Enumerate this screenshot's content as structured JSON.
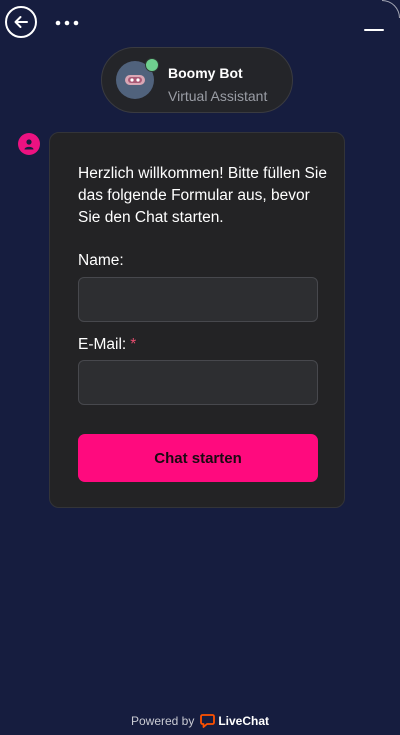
{
  "header": {
    "back_icon": "arrow-left-icon",
    "more_icon": "more-horizontal-icon",
    "minimize_icon": "minimize-icon"
  },
  "agent": {
    "name": "Boomy Bot",
    "role": "Virtual Assistant",
    "status": "online",
    "status_color": "#6fd08f"
  },
  "message": {
    "sender_icon": "user-icon",
    "text": "Herzlich willkommen! Bitte füllen Sie das folgende Formular aus, bevor Sie den Chat starten."
  },
  "form": {
    "name_label": "Name:",
    "name_value": "",
    "email_label": "E-Mail:",
    "email_required_mark": "*",
    "email_value": "",
    "submit_label": "Chat starten"
  },
  "footer": {
    "powered_by": "Powered by",
    "brand_name": "LiveChat",
    "brand_icon": "livechat-logo-icon"
  },
  "colors": {
    "background": "#161d3f",
    "card": "#232325",
    "accent": "#ff0a7e",
    "brand_orange": "#ff5100"
  }
}
